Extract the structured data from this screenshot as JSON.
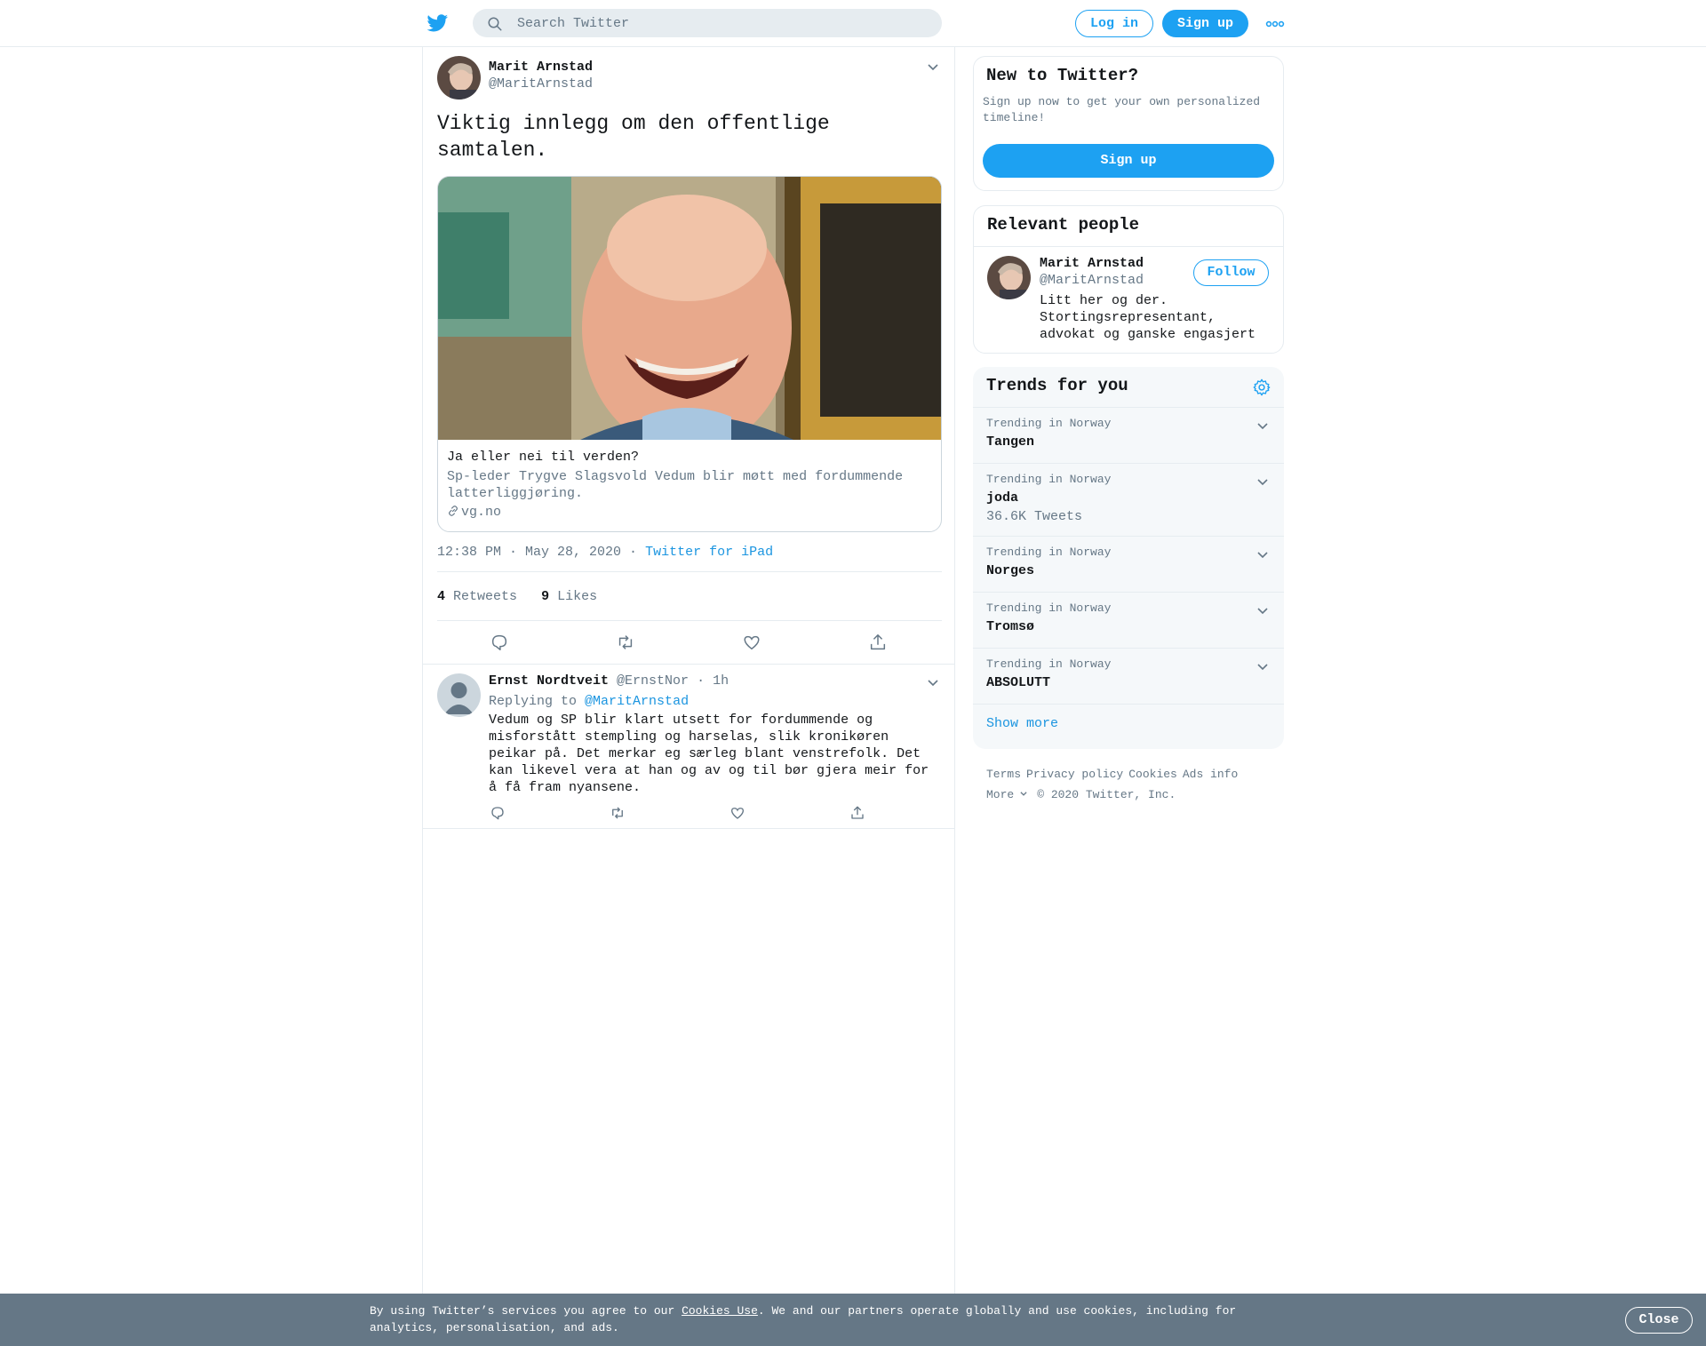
{
  "header": {
    "search_placeholder": "Search Twitter",
    "login_label": "Log in",
    "signup_label": "Sign up"
  },
  "tweet": {
    "author_name": "Marit Arnstad",
    "author_handle": "@MaritArnstad",
    "text": "Viktig innlegg om den offentlige samtalen.",
    "card": {
      "title": "Ja eller nei til verden?",
      "description": "Sp-leder Trygve Slagsvold Vedum blir møtt med fordummende latterliggjøring.",
      "domain": "vg.no"
    },
    "time": "12:38 PM · May 28, 2020",
    "separator": " · ",
    "source": "Twitter for iPad",
    "retweets_count": "4",
    "retweets_label": "Retweets",
    "likes_count": "9",
    "likes_label": "Likes"
  },
  "reply": {
    "author_name": "Ernst Nordtveit",
    "author_handle": "@ErnstNor",
    "time": "· 1h",
    "replying_to_label": "Replying to",
    "replying_to_handle": "@MaritArnstad",
    "text": "Vedum og SP blir klart utsett for fordummende og misforstått stempling og harselas, slik kronikøren peikar på. Det merkar eg særleg blant venstrefolk. Det kan likevel vera at han og av og til bør gjera meir for å få fram nyansene."
  },
  "sidebar": {
    "new_title": "New to Twitter?",
    "new_desc": "Sign up now to get your own personalized timeline!",
    "signup_label": "Sign up",
    "relevant_title": "Relevant people",
    "person_name": "Marit Arnstad",
    "person_handle": "@MaritArnstad",
    "follow_label": "Follow",
    "person_bio": "Litt her og der. Stortingsrepresentant, advokat og ganske engasjert",
    "trends_title": "Trends for you",
    "trends": [
      {
        "context": "Trending in Norway",
        "name": "Tangen",
        "count": ""
      },
      {
        "context": "Trending in Norway",
        "name": "joda",
        "count": "36.6K Tweets"
      },
      {
        "context": "Trending in Norway",
        "name": "Norges",
        "count": ""
      },
      {
        "context": "Trending in Norway",
        "name": "Tromsø",
        "count": ""
      },
      {
        "context": "Trending in Norway",
        "name": "ABSOLUTT",
        "count": ""
      }
    ],
    "show_more": "Show more",
    "footer": {
      "terms": "Terms",
      "privacy": "Privacy policy",
      "cookies": "Cookies",
      "ads": "Ads info",
      "more": "More",
      "copyright": "© 2020 Twitter, Inc."
    }
  },
  "cookie_bar": {
    "text_before": "By using Twitter’s services you agree to our ",
    "link": "Cookies Use",
    "text_after": ". We and our partners operate globally and use cookies, including for analytics, personalisation, and ads.",
    "close_label": "Close"
  },
  "colors": {
    "brand": "#1da1f2",
    "link": "#1b95e0",
    "muted": "#657786",
    "border": "#e6ecf0"
  }
}
